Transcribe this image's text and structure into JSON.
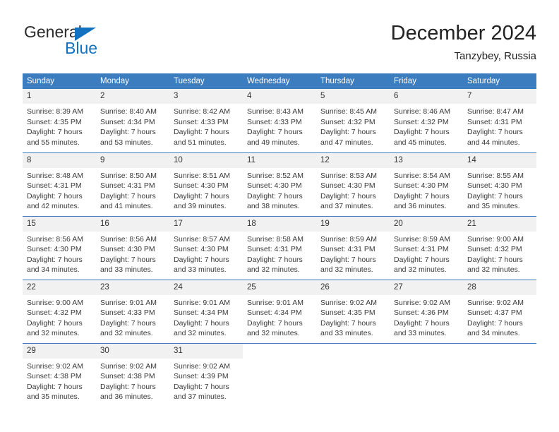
{
  "brand": {
    "name_top": "General",
    "name_bottom": "Blue",
    "accent_color": "#1272c0"
  },
  "header": {
    "title": "December 2024",
    "subtitle": "Tanzybey, Russia"
  },
  "theme": {
    "header_bg": "#3b7dbf",
    "daynum_bg": "#f1f1f1",
    "row_border": "#3b7dbf"
  },
  "calendar": {
    "weekdays": [
      "Sunday",
      "Monday",
      "Tuesday",
      "Wednesday",
      "Thursday",
      "Friday",
      "Saturday"
    ],
    "weeks": [
      [
        {
          "day": "1",
          "sunrise": "Sunrise: 8:39 AM",
          "sunset": "Sunset: 4:35 PM",
          "daylight1": "Daylight: 7 hours",
          "daylight2": "and 55 minutes."
        },
        {
          "day": "2",
          "sunrise": "Sunrise: 8:40 AM",
          "sunset": "Sunset: 4:34 PM",
          "daylight1": "Daylight: 7 hours",
          "daylight2": "and 53 minutes."
        },
        {
          "day": "3",
          "sunrise": "Sunrise: 8:42 AM",
          "sunset": "Sunset: 4:33 PM",
          "daylight1": "Daylight: 7 hours",
          "daylight2": "and 51 minutes."
        },
        {
          "day": "4",
          "sunrise": "Sunrise: 8:43 AM",
          "sunset": "Sunset: 4:33 PM",
          "daylight1": "Daylight: 7 hours",
          "daylight2": "and 49 minutes."
        },
        {
          "day": "5",
          "sunrise": "Sunrise: 8:45 AM",
          "sunset": "Sunset: 4:32 PM",
          "daylight1": "Daylight: 7 hours",
          "daylight2": "and 47 minutes."
        },
        {
          "day": "6",
          "sunrise": "Sunrise: 8:46 AM",
          "sunset": "Sunset: 4:32 PM",
          "daylight1": "Daylight: 7 hours",
          "daylight2": "and 45 minutes."
        },
        {
          "day": "7",
          "sunrise": "Sunrise: 8:47 AM",
          "sunset": "Sunset: 4:31 PM",
          "daylight1": "Daylight: 7 hours",
          "daylight2": "and 44 minutes."
        }
      ],
      [
        {
          "day": "8",
          "sunrise": "Sunrise: 8:48 AM",
          "sunset": "Sunset: 4:31 PM",
          "daylight1": "Daylight: 7 hours",
          "daylight2": "and 42 minutes."
        },
        {
          "day": "9",
          "sunrise": "Sunrise: 8:50 AM",
          "sunset": "Sunset: 4:31 PM",
          "daylight1": "Daylight: 7 hours",
          "daylight2": "and 41 minutes."
        },
        {
          "day": "10",
          "sunrise": "Sunrise: 8:51 AM",
          "sunset": "Sunset: 4:30 PM",
          "daylight1": "Daylight: 7 hours",
          "daylight2": "and 39 minutes."
        },
        {
          "day": "11",
          "sunrise": "Sunrise: 8:52 AM",
          "sunset": "Sunset: 4:30 PM",
          "daylight1": "Daylight: 7 hours",
          "daylight2": "and 38 minutes."
        },
        {
          "day": "12",
          "sunrise": "Sunrise: 8:53 AM",
          "sunset": "Sunset: 4:30 PM",
          "daylight1": "Daylight: 7 hours",
          "daylight2": "and 37 minutes."
        },
        {
          "day": "13",
          "sunrise": "Sunrise: 8:54 AM",
          "sunset": "Sunset: 4:30 PM",
          "daylight1": "Daylight: 7 hours",
          "daylight2": "and 36 minutes."
        },
        {
          "day": "14",
          "sunrise": "Sunrise: 8:55 AM",
          "sunset": "Sunset: 4:30 PM",
          "daylight1": "Daylight: 7 hours",
          "daylight2": "and 35 minutes."
        }
      ],
      [
        {
          "day": "15",
          "sunrise": "Sunrise: 8:56 AM",
          "sunset": "Sunset: 4:30 PM",
          "daylight1": "Daylight: 7 hours",
          "daylight2": "and 34 minutes."
        },
        {
          "day": "16",
          "sunrise": "Sunrise: 8:56 AM",
          "sunset": "Sunset: 4:30 PM",
          "daylight1": "Daylight: 7 hours",
          "daylight2": "and 33 minutes."
        },
        {
          "day": "17",
          "sunrise": "Sunrise: 8:57 AM",
          "sunset": "Sunset: 4:30 PM",
          "daylight1": "Daylight: 7 hours",
          "daylight2": "and 33 minutes."
        },
        {
          "day": "18",
          "sunrise": "Sunrise: 8:58 AM",
          "sunset": "Sunset: 4:31 PM",
          "daylight1": "Daylight: 7 hours",
          "daylight2": "and 32 minutes."
        },
        {
          "day": "19",
          "sunrise": "Sunrise: 8:59 AM",
          "sunset": "Sunset: 4:31 PM",
          "daylight1": "Daylight: 7 hours",
          "daylight2": "and 32 minutes."
        },
        {
          "day": "20",
          "sunrise": "Sunrise: 8:59 AM",
          "sunset": "Sunset: 4:31 PM",
          "daylight1": "Daylight: 7 hours",
          "daylight2": "and 32 minutes."
        },
        {
          "day": "21",
          "sunrise": "Sunrise: 9:00 AM",
          "sunset": "Sunset: 4:32 PM",
          "daylight1": "Daylight: 7 hours",
          "daylight2": "and 32 minutes."
        }
      ],
      [
        {
          "day": "22",
          "sunrise": "Sunrise: 9:00 AM",
          "sunset": "Sunset: 4:32 PM",
          "daylight1": "Daylight: 7 hours",
          "daylight2": "and 32 minutes."
        },
        {
          "day": "23",
          "sunrise": "Sunrise: 9:01 AM",
          "sunset": "Sunset: 4:33 PM",
          "daylight1": "Daylight: 7 hours",
          "daylight2": "and 32 minutes."
        },
        {
          "day": "24",
          "sunrise": "Sunrise: 9:01 AM",
          "sunset": "Sunset: 4:34 PM",
          "daylight1": "Daylight: 7 hours",
          "daylight2": "and 32 minutes."
        },
        {
          "day": "25",
          "sunrise": "Sunrise: 9:01 AM",
          "sunset": "Sunset: 4:34 PM",
          "daylight1": "Daylight: 7 hours",
          "daylight2": "and 32 minutes."
        },
        {
          "day": "26",
          "sunrise": "Sunrise: 9:02 AM",
          "sunset": "Sunset: 4:35 PM",
          "daylight1": "Daylight: 7 hours",
          "daylight2": "and 33 minutes."
        },
        {
          "day": "27",
          "sunrise": "Sunrise: 9:02 AM",
          "sunset": "Sunset: 4:36 PM",
          "daylight1": "Daylight: 7 hours",
          "daylight2": "and 33 minutes."
        },
        {
          "day": "28",
          "sunrise": "Sunrise: 9:02 AM",
          "sunset": "Sunset: 4:37 PM",
          "daylight1": "Daylight: 7 hours",
          "daylight2": "and 34 minutes."
        }
      ],
      [
        {
          "day": "29",
          "sunrise": "Sunrise: 9:02 AM",
          "sunset": "Sunset: 4:38 PM",
          "daylight1": "Daylight: 7 hours",
          "daylight2": "and 35 minutes."
        },
        {
          "day": "30",
          "sunrise": "Sunrise: 9:02 AM",
          "sunset": "Sunset: 4:38 PM",
          "daylight1": "Daylight: 7 hours",
          "daylight2": "and 36 minutes."
        },
        {
          "day": "31",
          "sunrise": "Sunrise: 9:02 AM",
          "sunset": "Sunset: 4:39 PM",
          "daylight1": "Daylight: 7 hours",
          "daylight2": "and 37 minutes."
        },
        {
          "day": "",
          "sunrise": "",
          "sunset": "",
          "daylight1": "",
          "daylight2": ""
        },
        {
          "day": "",
          "sunrise": "",
          "sunset": "",
          "daylight1": "",
          "daylight2": ""
        },
        {
          "day": "",
          "sunrise": "",
          "sunset": "",
          "daylight1": "",
          "daylight2": ""
        },
        {
          "day": "",
          "sunrise": "",
          "sunset": "",
          "daylight1": "",
          "daylight2": ""
        }
      ]
    ]
  }
}
